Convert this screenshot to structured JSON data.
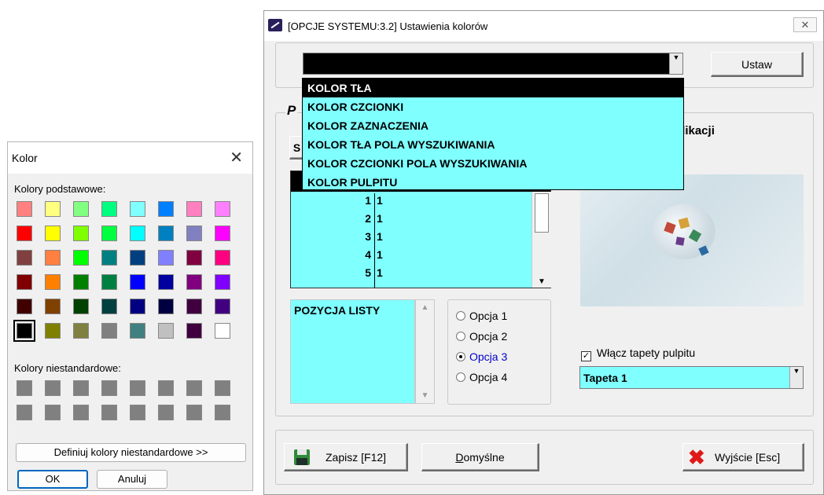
{
  "color_dialog": {
    "title": "Kolor",
    "close_glyph": "✕",
    "basic_colors_label": "Kolory podstawowe:",
    "custom_colors_label": "Kolory niestandardowe:",
    "define_custom_button": "Definiuj kolory niestandardowe >>",
    "ok_button": "OK",
    "cancel_button": "Anuluj",
    "basic_colors": [
      [
        "#ff8080",
        "#ffff80",
        "#80ff80",
        "#00ff80",
        "#80ffff",
        "#0080ff",
        "#ff80c0",
        "#ff80ff"
      ],
      [
        "#ff0000",
        "#ffff00",
        "#80ff00",
        "#00ff40",
        "#00ffff",
        "#0080c0",
        "#8080c0",
        "#ff00ff"
      ],
      [
        "#804040",
        "#ff8040",
        "#00ff00",
        "#008080",
        "#004080",
        "#8080ff",
        "#800040",
        "#ff0080"
      ],
      [
        "#800000",
        "#ff8000",
        "#008000",
        "#008040",
        "#0000ff",
        "#0000a0",
        "#800080",
        "#8000ff"
      ],
      [
        "#400000",
        "#804000",
        "#004000",
        "#004040",
        "#000080",
        "#000040",
        "#400040",
        "#400080"
      ],
      [
        "#000000",
        "#808000",
        "#808040",
        "#808080",
        "#408080",
        "#c0c0c0",
        "#400040",
        "#ffffff"
      ]
    ],
    "selected_color": "#000000",
    "custom_color_placeholder": "#808080"
  },
  "main_window": {
    "title": "[OPCJE SYSTEMU:3.2]  Ustawienia kolorów",
    "close_glyph": "✕",
    "set_button": "Ustaw",
    "color_target_options": [
      "KOLOR TŁA",
      "KOLOR CZCIONKI",
      "KOLOR ZAZNACZENIA",
      "KOLOR TŁA POLA WYSZUKIWANIA",
      "KOLOR CZCIONKI POLA WYSZUKIWANIA",
      "KOLOR PULPITU"
    ],
    "selected_option": "KOLOR TŁA",
    "hidden_group_initial": "P",
    "hidden_button_initial": "S",
    "app_label_fragment": "plikacji",
    "grid_rows": [
      {
        "n": "1",
        "v": "1"
      },
      {
        "n": "2",
        "v": "1"
      },
      {
        "n": "3",
        "v": "1"
      },
      {
        "n": "4",
        "v": "1"
      },
      {
        "n": "5",
        "v": "1"
      }
    ],
    "list_item": "POZYCJA LISTY",
    "radio_options": [
      {
        "label": "Opcja 1",
        "checked": false
      },
      {
        "label": "Opcja 2",
        "checked": false
      },
      {
        "label": "Opcja 3",
        "checked": true
      },
      {
        "label": "Opcja 4",
        "checked": false
      }
    ],
    "wallpaper_checkbox_label": "Włącz tapety pulpitu",
    "wallpaper_checked": true,
    "wallpaper_selected": "Tapeta 1",
    "save_button": "Zapisz  [F12]",
    "defaults_button_underlined": "D",
    "defaults_button_rest": "omyślne",
    "exit_button": "Wyjście  [Esc]",
    "accent_cyan": "#80ffff",
    "radio_checked_color": "#0000cc"
  }
}
